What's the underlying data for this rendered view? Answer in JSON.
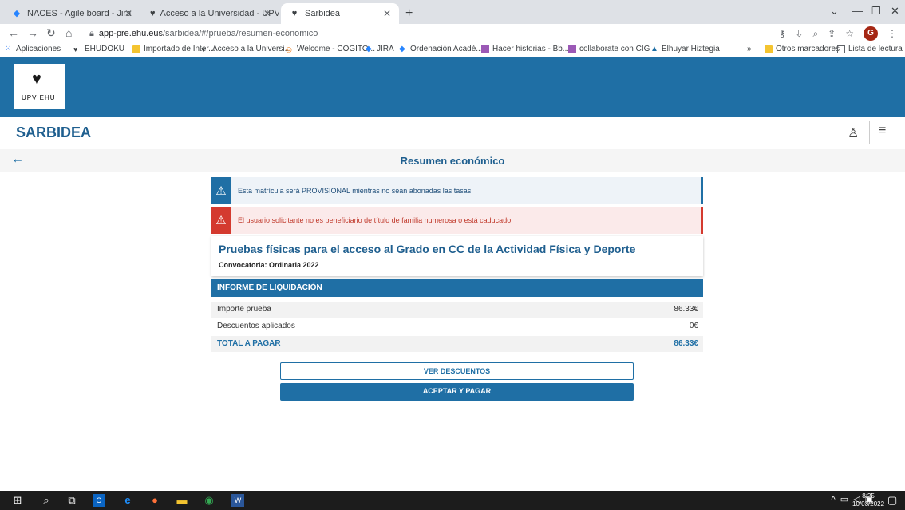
{
  "browser": {
    "tabs": [
      {
        "label": "NACES - Agile board - Jira",
        "icon": "jira-icon"
      },
      {
        "label": "Acceso a la Universidad - UPV/EH",
        "icon": "ehu-icon"
      },
      {
        "label": "Sarbidea",
        "icon": "ehu-icon",
        "active": true
      }
    ],
    "url_host": "app-pre.ehu.eus",
    "url_path": "/sarbidea/#/prueba/resumen-economico",
    "profile_initial": "G",
    "bookmarks": [
      "Aplicaciones",
      "EHUDOKU",
      "Importado de Inter...",
      "Acceso a la Universi...",
      "Welcome - COGITO...",
      "JIRA",
      "Ordenación Acadé...",
      "Hacer historias - Bb...",
      "collaborate con CIG",
      "Elhuyar Hiztegia",
      "»",
      "Otros marcadores",
      "Lista de lectura"
    ]
  },
  "header": {
    "logo_text": "UPV  EHU",
    "app_title": "SARBIDEA"
  },
  "subheader": {
    "title": "Resumen económico"
  },
  "alerts": {
    "info": "Esta matrícula será PROVISIONAL mientras no sean abonadas las tasas",
    "error": "El usuario solicitante no es beneficiario de título de familia numerosa o está caducado."
  },
  "exam": {
    "title": "Pruebas físicas para el acceso al Grado en CC de la Actividad Física y Deporte",
    "convocatoria": "Convocatoria: Ordinaria 2022"
  },
  "liquidacion": {
    "heading": "INFORME DE LIQUIDACIÓN",
    "rows": [
      {
        "label": "Importe prueba",
        "value": "86.33€"
      },
      {
        "label": "Descuentos aplicados",
        "value": "0€"
      },
      {
        "label": "TOTAL A PAGAR",
        "value": "86.33€"
      }
    ]
  },
  "actions": {
    "ver_descuentos": "VER DESCUENTOS",
    "aceptar_pagar": "ACEPTAR Y PAGAR"
  },
  "taskbar": {
    "time": "8:25",
    "date": "10/03/2022"
  },
  "colors": {
    "brand_blue": "#1f6fa5",
    "error_red": "#d43a2f"
  }
}
